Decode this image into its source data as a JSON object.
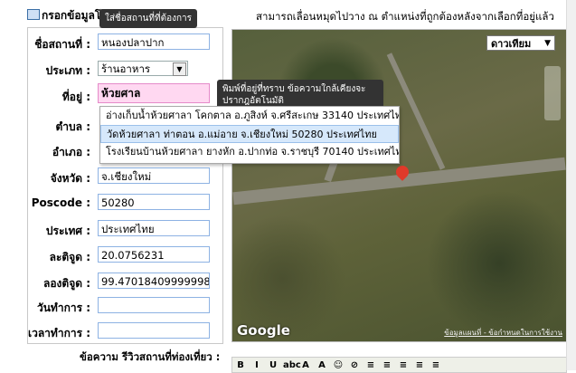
{
  "header": {
    "form_title": "กรอกข้อมูลโ",
    "map_hint": "สามารถเลื่อนหมุดไปวาง ณ ตำแหน่งที่ถูกต้องหลังจากเลือกที่อยู่แล้ว"
  },
  "tooltips": {
    "name_hint": "ใส่ชื่อสถานที่ที่ต้องการ",
    "address_hint": "พิมพ์ที่อยู่ที่ทราบ ข้อความใกล้เคียงจะปรากฎอัตโนมัติ"
  },
  "form": {
    "name": {
      "label": "ชื่อสถานที่ :",
      "value": "หนองปลาปาก"
    },
    "type": {
      "label": "ประเภท :",
      "value": "ร้านอาหาร"
    },
    "address": {
      "label": "ที่อยู่ :",
      "value": "ห้วยศาล"
    },
    "tambon": {
      "label": "ตำบล :"
    },
    "amphoe": {
      "label": "อำเภอ :"
    },
    "province": {
      "label": "จังหวัด :",
      "value": "จ.เชียงใหม่"
    },
    "postcode": {
      "label": "Poscode :",
      "value": "50280"
    },
    "country": {
      "label": "ประเทศ :",
      "value": "ประเทศไทย"
    },
    "latitude": {
      "label": "ละติจูด :",
      "value": "20.0756231"
    },
    "longitude": {
      "label": "ลองติจูด :",
      "value": "99.47018409999998"
    },
    "workdays": {
      "label": "วันทำการ :",
      "value": ""
    },
    "workhours": {
      "label": "เวลาทำการ :",
      "value": ""
    }
  },
  "suggestions": [
    "อ่างเก็บน้ำห้วยศาลา โคกตาล อ.ภูสิงห์ จ.ศรีสะเกษ 33140 ประเทศไทย",
    "วัดห้วยศาลา ท่าตอน อ.แม่อาย จ.เชียงใหม่ 50280 ประเทศไทย",
    "โรงเรียนบ้านห้วยศาลา ยางหัก อ.ปากท่อ จ.ราชบุรี 70140 ประเทศไทย"
  ],
  "map": {
    "type_selector": "ดาวเทียม",
    "logo": "Google",
    "copyright": "ข้อมูลแผนที่ - ข้อกำหนดในการใช้งาน"
  },
  "review": {
    "label": "ข้อความ รีวิวสถานที่ท่องเที่ยว :"
  },
  "toolbar": [
    "B",
    "I",
    "U",
    "abc",
    "A",
    "A",
    "☺",
    "⊘",
    "≡",
    "≡",
    "≡",
    "≡",
    "≡"
  ]
}
